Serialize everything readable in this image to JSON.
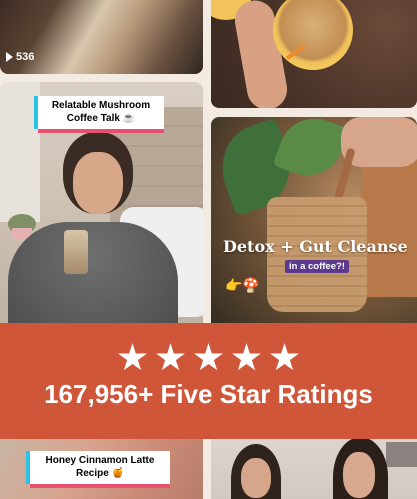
{
  "tiles": {
    "tile1": {
      "view_count": "536"
    },
    "tile3": {
      "title_line1": "Relatable Mushroom",
      "title_line2": "Coffee Talk ☕"
    },
    "tile4": {
      "overlay_title": "Detox + Gut Cleanse",
      "overlay_subtitle": "in a coffee?!",
      "overlay_emojis": "👉🍄"
    },
    "tile5": {
      "title_line1": "Honey Cinnamon Latte",
      "title_line2": "Recipe 🍯"
    }
  },
  "banner": {
    "star_count": 5,
    "text": "167,956+ Five Star Ratings",
    "color": "#cf5638"
  },
  "colors": {
    "background": "#f3ebe1",
    "card_accent_left": "#2ac3e6",
    "card_accent_bottom": "#e8506d"
  }
}
